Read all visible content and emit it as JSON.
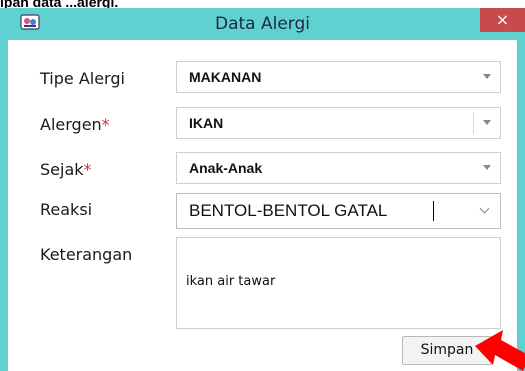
{
  "top_partial_text": "ipan data ...alergi.",
  "window": {
    "title": "Data Alergi",
    "close_glyph": "×",
    "accent_color": "#5fd1d0",
    "close_color": "#c74b4b"
  },
  "form": {
    "tipe_alergi": {
      "label": "Tipe Alergi",
      "value": "MAKANAN"
    },
    "alergen": {
      "label": "Alergen",
      "required_mark": "*",
      "value": "IKAN"
    },
    "sejak": {
      "label": "Sejak",
      "required_mark": "*",
      "value": "Anak-Anak"
    },
    "reaksi": {
      "label": "Reaksi",
      "value": "BENTOL-BENTOL GATAL"
    },
    "keterangan": {
      "label": "Keterangan",
      "value": "ikan air tawar"
    }
  },
  "buttons": {
    "save": "Simpan"
  },
  "annotation": {
    "arrow_color": "#ff0000"
  }
}
